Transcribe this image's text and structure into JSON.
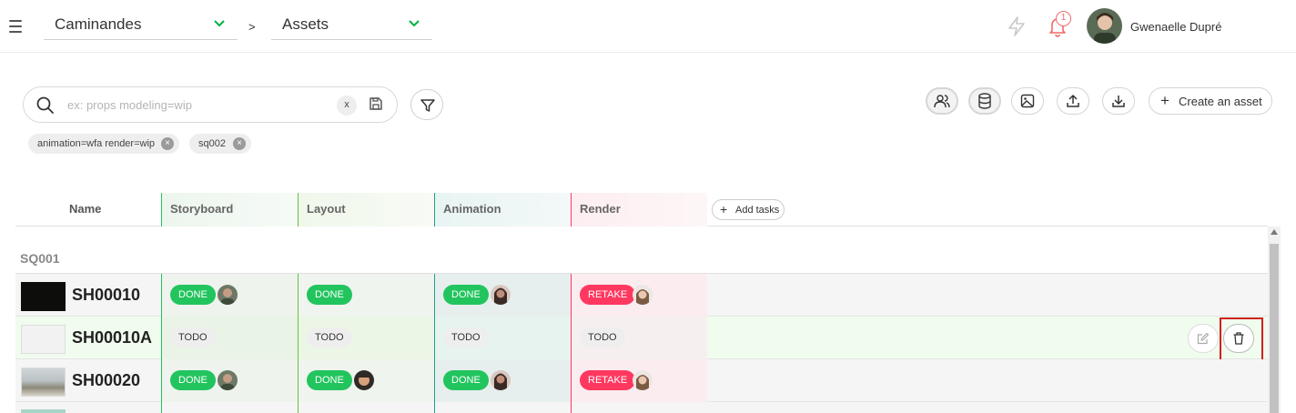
{
  "topbar": {
    "production": "Caminandes",
    "separator": ">",
    "section": "Assets",
    "notification_count": "1",
    "user_name": "Gwenaelle Dupré"
  },
  "search": {
    "placeholder": "ex: props modeling=wip",
    "clear_label": "x"
  },
  "saved_filters": [
    "animation=wfa render=wip",
    "sq002"
  ],
  "toolbar": {
    "create_label": "Create an asset"
  },
  "table": {
    "name_header": "Name",
    "add_tasks_label": "Add tasks",
    "task_columns": [
      {
        "name": "Storyboard",
        "color": "#22c45e"
      },
      {
        "name": "Layout",
        "color": "#67c23a"
      },
      {
        "name": "Animation",
        "color": "#1f9e8f"
      },
      {
        "name": "Render",
        "color": "#ff3860"
      }
    ],
    "group": "SQ001",
    "rows": [
      {
        "name": "SH00010",
        "cells": [
          {
            "status": "DONE"
          },
          {
            "status": "DONE"
          },
          {
            "status": "DONE"
          },
          {
            "status": "RETAKE"
          }
        ]
      },
      {
        "name": "SH00010A",
        "cells": [
          {
            "status": "TODO"
          },
          {
            "status": "TODO"
          },
          {
            "status": "TODO"
          },
          {
            "status": "TODO"
          }
        ]
      },
      {
        "name": "SH00020",
        "cells": [
          {
            "status": "DONE"
          },
          {
            "status": "DONE"
          },
          {
            "status": "DONE"
          },
          {
            "status": "RETAKE"
          }
        ]
      }
    ]
  },
  "colors": {
    "done": "#22c45e",
    "retake": "#ff3860",
    "todo": "#eeeeee",
    "accent_green": "#00b242",
    "notification": "#f06a6a"
  }
}
